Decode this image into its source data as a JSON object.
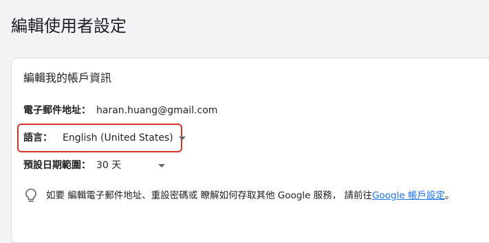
{
  "page": {
    "title": "編輯使用者設定"
  },
  "card": {
    "title": "編輯我的帳戶資訊",
    "email": {
      "label": "電子郵件地址：",
      "value": "haran.huang@gmail.com"
    },
    "language": {
      "label": "語言：",
      "value": "English (United States)",
      "icon": "dropdown-caret-icon"
    },
    "date_range": {
      "label": "預設日期範圍：",
      "value": "30 天",
      "icon": "dropdown-caret-icon"
    },
    "info": {
      "icon": "lightbulb-icon",
      "text": "如要 編輯電子郵件地址、重設密碼或 瞭解如何存取其他 Google 服務， 請前往 ",
      "link_text": "Google 帳戶設定",
      "suffix": "。"
    }
  },
  "colors": {
    "highlight": "#d93025",
    "link": "#1a73e8",
    "background": "#f1f3f4",
    "card": "#ffffff"
  }
}
